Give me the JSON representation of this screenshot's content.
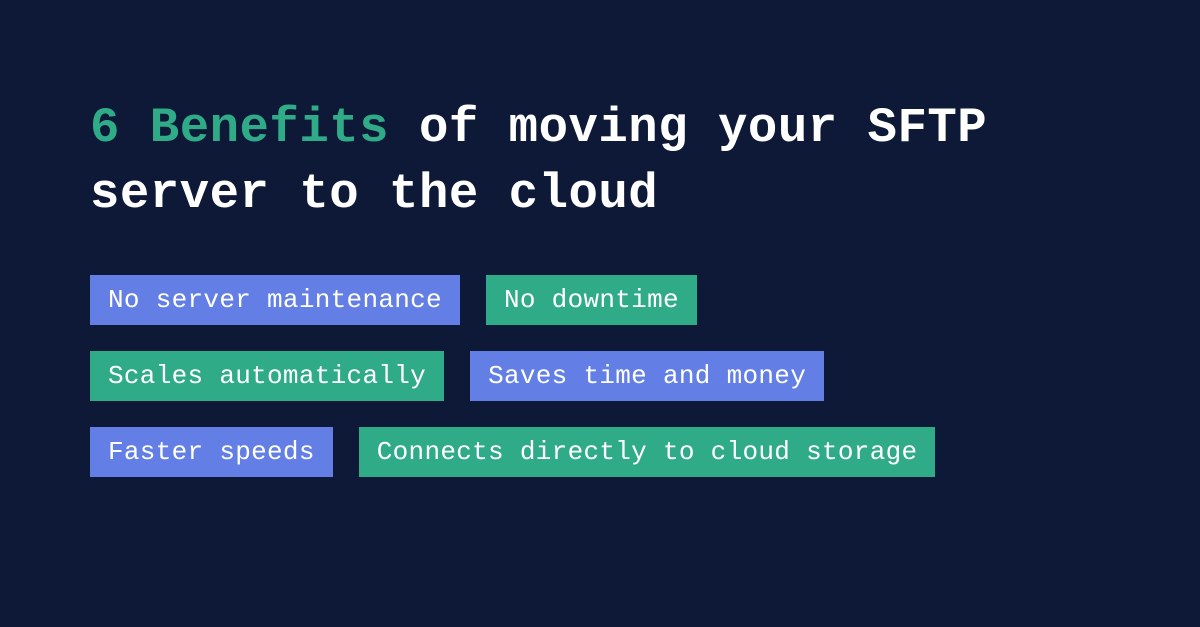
{
  "title": {
    "accent": "6 Benefits",
    "rest": " of moving your SFTP server to the cloud"
  },
  "badges": {
    "rows": [
      [
        {
          "label": "No server maintenance",
          "color": "blue"
        },
        {
          "label": "No downtime",
          "color": "green"
        }
      ],
      [
        {
          "label": "Scales automatically",
          "color": "green"
        },
        {
          "label": "Saves time and money",
          "color": "blue"
        }
      ],
      [
        {
          "label": "Faster speeds",
          "color": "blue"
        },
        {
          "label": "Connects directly to cloud storage",
          "color": "green"
        }
      ]
    ]
  }
}
